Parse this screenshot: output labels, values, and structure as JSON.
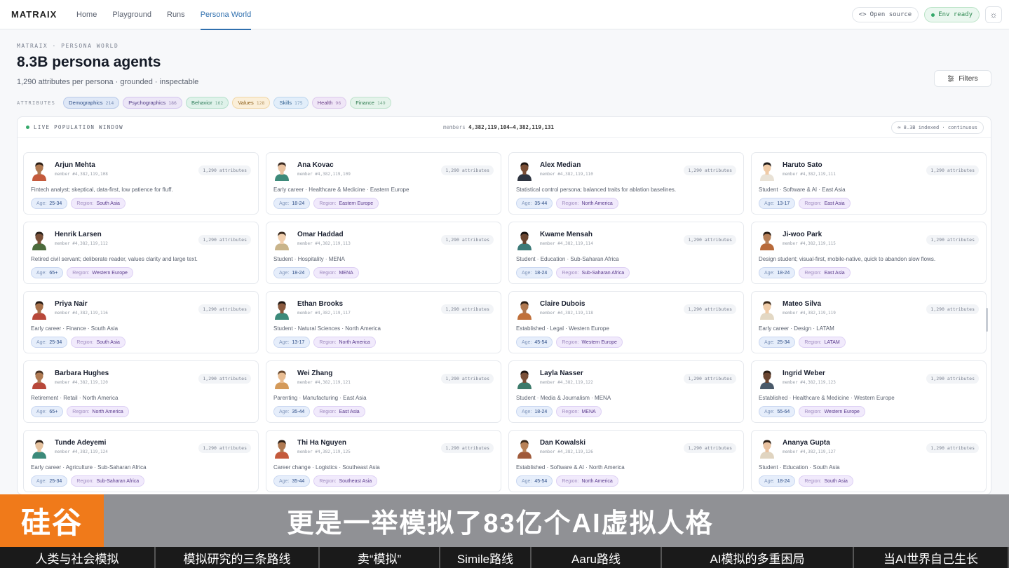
{
  "nav": {
    "brand": "MATRAIX",
    "links": [
      "Home",
      "Playground",
      "Runs",
      "Persona World"
    ],
    "active_index": 3,
    "open_source": "Open source",
    "env_status": "Env ready"
  },
  "header": {
    "crumb": "MATRAIX · PERSONA WORLD",
    "title": "8.3B persona agents",
    "subtitle": "1,290 attributes per persona · grounded · inspectable",
    "filters_label": "Filters",
    "attributes_label": "ATTRIBUTES",
    "attributes": [
      {
        "label": "Demographics",
        "count": "214",
        "bg": "#dfe8f7",
        "border": "#b9c9e8",
        "color": "#2d4d86"
      },
      {
        "label": "Psychographics",
        "count": "186",
        "bg": "#ece6f7",
        "border": "#d3c6ee",
        "color": "#4f3a84"
      },
      {
        "label": "Behavior",
        "count": "162",
        "bg": "#dff2ea",
        "border": "#b6e0cc",
        "color": "#2c7a58"
      },
      {
        "label": "Values",
        "count": "128",
        "bg": "#fbefd9",
        "border": "#f0d7a8",
        "color": "#8a5a14"
      },
      {
        "label": "Skills",
        "count": "175",
        "bg": "#e2eefa",
        "border": "#bdd6ee",
        "color": "#2d5f8f"
      },
      {
        "label": "Health",
        "count": "96",
        "bg": "#f0e6f7",
        "border": "#dccaec",
        "color": "#6a3f87"
      },
      {
        "label": "Finance",
        "count": "149",
        "bg": "#e4f3ea",
        "border": "#bfe2cd",
        "color": "#2f7a4f"
      }
    ]
  },
  "panel": {
    "live_label": "LIVE POPULATION WINDOW",
    "members_prefix": "members",
    "members_range": "4,382,119,104–4,382,119,131",
    "indexed_label": "8.3B indexed · continuous"
  },
  "card_labels": {
    "age_key": "Age:",
    "region_key": "Region:",
    "attrs": "1,290 attributes"
  },
  "personas": [
    {
      "name": "Arjun Mehta",
      "member": "member #4,382,119,108",
      "desc": "Fintech analyst; skeptical, data-first, low patience for fluff.",
      "age": "25-34",
      "region": "South Asia",
      "skin": "#b07a52",
      "hair": "#2a1d14",
      "shirt": "#c45a3c"
    },
    {
      "name": "Ana Kovac",
      "member": "member #4,382,119,109",
      "desc": "Early career · Healthcare & Medicine · Eastern Europe",
      "age": "18-24",
      "region": "Eastern Europe",
      "skin": "#e9c2a0",
      "hair": "#3b2a20",
      "shirt": "#3d8a7a"
    },
    {
      "name": "Alex Median",
      "member": "member #4,382,119,110",
      "desc": "Statistical control persona; balanced traits for ablation baselines.",
      "age": "35-44",
      "region": "North America",
      "skin": "#7a4e35",
      "hair": "#1c1410",
      "shirt": "#2e3440"
    },
    {
      "name": "Haruto Sato",
      "member": "member #4,382,119,111",
      "desc": "Student · Software & AI · East Asia",
      "age": "13-17",
      "region": "East Asia",
      "skin": "#f0cba7",
      "hair": "#1e1a18",
      "shirt": "#e9e2d6"
    },
    {
      "name": "Henrik Larsen",
      "member": "member #4,382,119,112",
      "desc": "Retired civil servant; deliberate reader, values clarity and large text.",
      "age": "65+",
      "region": "Western Europe",
      "skin": "#7a5038",
      "hair": "#2a211a",
      "shirt": "#4c6b3c"
    },
    {
      "name": "Omar Haddad",
      "member": "member #4,382,119,113",
      "desc": "Student · Hospitality · MENA",
      "age": "18-24",
      "region": "MENA",
      "skin": "#f1cfae",
      "hair": "#3a2a1e",
      "shirt": "#c9b48a"
    },
    {
      "name": "Kwame Mensah",
      "member": "member #4,382,119,114",
      "desc": "Student · Education · Sub-Saharan Africa",
      "age": "18-24",
      "region": "Sub-Saharan Africa",
      "skin": "#6a4530",
      "hair": "#161210",
      "shirt": "#3c7a78"
    },
    {
      "name": "Ji-woo Park",
      "member": "member #4,382,119,115",
      "desc": "Design student; visual-first, mobile-native, quick to abandon slow flows.",
      "age": "18-24",
      "region": "East Asia",
      "skin": "#b78058",
      "hair": "#2a1d14",
      "shirt": "#b86a3a"
    },
    {
      "name": "Priya Nair",
      "member": "member #4,382,119,116",
      "desc": "Early career · Finance · South Asia",
      "age": "25-34",
      "region": "South Asia",
      "skin": "#a8714a",
      "hair": "#231812",
      "shirt": "#b8483a"
    },
    {
      "name": "Ethan Brooks",
      "member": "member #4,382,119,117",
      "desc": "Student · Natural Sciences · North America",
      "age": "13-17",
      "region": "North America",
      "skin": "#8a5a3e",
      "hair": "#1e1612",
      "shirt": "#3c8a7a"
    },
    {
      "name": "Claire Dubois",
      "member": "member #4,382,119,118",
      "desc": "Established · Legal · Western Europe",
      "age": "45-54",
      "region": "Western Europe",
      "skin": "#b07850",
      "hair": "#2a1d14",
      "shirt": "#c0703a"
    },
    {
      "name": "Mateo Silva",
      "member": "member #4,382,119,119",
      "desc": "Early career · Design · LATAM",
      "age": "25-34",
      "region": "LATAM",
      "skin": "#f0cca8",
      "hair": "#3a2818",
      "shirt": "#e3d8c4"
    },
    {
      "name": "Barbara Hughes",
      "member": "member #4,382,119,120",
      "desc": "Retirement · Retail · North America",
      "age": "65+",
      "region": "North America",
      "skin": "#b07a52",
      "hair": "#4a3426",
      "shirt": "#b8483a"
    },
    {
      "name": "Wei Zhang",
      "member": "member #4,382,119,121",
      "desc": "Parenting · Manufacturing · East Asia",
      "age": "35-44",
      "region": "East Asia",
      "skin": "#e9bd92",
      "hair": "#6a4a30",
      "shirt": "#d49a5a"
    },
    {
      "name": "Layla Nasser",
      "member": "member #4,382,119,122",
      "desc": "Student · Media & Journalism · MENA",
      "age": "18-24",
      "region": "MENA",
      "skin": "#7a5038",
      "hair": "#1e1612",
      "shirt": "#3c7a6a"
    },
    {
      "name": "Ingrid Weber",
      "member": "member #4,382,119,123",
      "desc": "Established · Healthcare & Medicine · Western Europe",
      "age": "55-64",
      "region": "Western Europe",
      "skin": "#6a4530",
      "hair": "#2a1d14",
      "shirt": "#4a5a6a"
    },
    {
      "name": "Tunde Adeyemi",
      "member": "member #4,382,119,124",
      "desc": "Early career · Agriculture · Sub-Saharan Africa",
      "age": "25-34",
      "region": "Sub-Saharan Africa",
      "skin": "#e6c29e",
      "hair": "#2a1d14",
      "shirt": "#3c8a7a"
    },
    {
      "name": "Thi Ha Nguyen",
      "member": "member #4,382,119,125",
      "desc": "Career change · Logistics · Southeast Asia",
      "age": "35-44",
      "region": "Southeast Asia",
      "skin": "#b07a52",
      "hair": "#2a1d14",
      "shirt": "#c45a3c"
    },
    {
      "name": "Dan Kowalski",
      "member": "member #4,382,119,126",
      "desc": "Established · Software & AI · North America",
      "age": "45-54",
      "region": "North America",
      "skin": "#b88258",
      "hair": "#3a2818",
      "shirt": "#a05a3a"
    },
    {
      "name": "Ananya Gupta",
      "member": "member #4,382,119,127",
      "desc": "Student · Education · South Asia",
      "age": "18-24",
      "region": "South Asia",
      "skin": "#e9c2a0",
      "hair": "#2a1d14",
      "shirt": "#e0d4c0"
    }
  ],
  "overlay": {
    "logo": "硅谷",
    "caption": "更是一举模拟了83亿个AI虚拟人格",
    "chapters": [
      {
        "label": "人类与社会模拟",
        "w": 222,
        "bg": "#1a1a1a"
      },
      {
        "label": "模拟研究的三条路线",
        "w": 234,
        "bg": "#1a1a1a"
      },
      {
        "label": "卖“模拟”",
        "w": 172,
        "bg": "#1a1a1a"
      },
      {
        "label": "Simile路线",
        "w": 130,
        "bg": "#1a1a1a"
      },
      {
        "label": "Aaru路线",
        "w": 186,
        "bg": "#1a1a1a"
      },
      {
        "label": "AI模拟的多重困局",
        "w": 274,
        "bg": "#1a1a1a"
      },
      {
        "label": "当AI世界自己生长",
        "w": 221,
        "bg": "#1a1a1a"
      }
    ]
  }
}
